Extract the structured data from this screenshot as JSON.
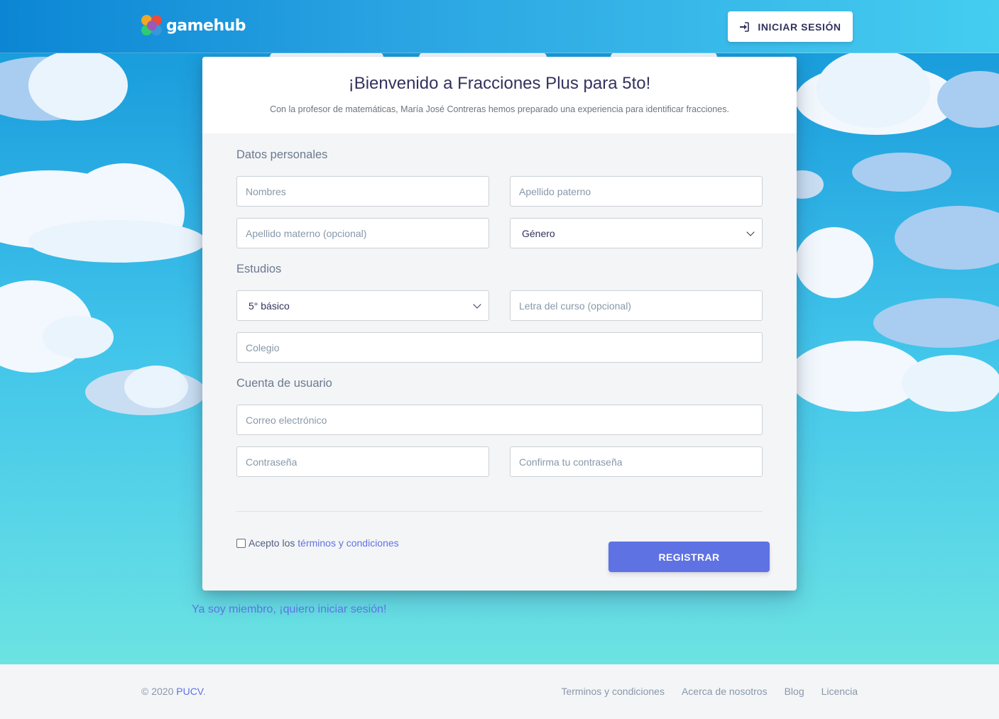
{
  "navbar": {
    "brand_name": "gamehub",
    "login_label": "INICIAR SESIÓN"
  },
  "card": {
    "title": "¡Bienvenido a Fracciones Plus para 5to!",
    "subtitle": "Con la profesor de matemáticas, María José Contreras hemos preparado una experiencia para identificar fracciones.",
    "sections": {
      "personal": "Datos personales",
      "studies": "Estudios",
      "account": "Cuenta de usuario"
    },
    "fields": {
      "nombres": "Nombres",
      "apellido_paterno": "Apellido paterno",
      "apellido_materno": "Apellido materno (opcional)",
      "genero": "Género",
      "curso": "5° básico",
      "letra_curso": "Letra del curso (opcional)",
      "colegio": "Colegio",
      "correo": "Correo electrónico",
      "contrasena": "Contraseña",
      "confirma_contrasena": "Confirma tu contraseña"
    },
    "terms_prefix": "Acepto los",
    "terms_link": "términos y condiciones",
    "register_label": "REGISTRAR"
  },
  "member_link": "Ya soy miembro, ¡quiero iniciar sesión!",
  "footer": {
    "copyright_prefix": "© 2020",
    "copyright_link": "PUCV",
    "copyright_suffix": ".",
    "links": [
      "Terminos y condiciones",
      "Acerca de nosotros",
      "Blog",
      "Licencia"
    ]
  },
  "colors": {
    "accent": "#5e72e4",
    "heading": "#32325d",
    "sky_top": "#1297d8",
    "sky_bottom": "#6ce3e2"
  },
  "icons": {
    "login": "sign-in-icon",
    "select": "chevron-down-icon"
  }
}
